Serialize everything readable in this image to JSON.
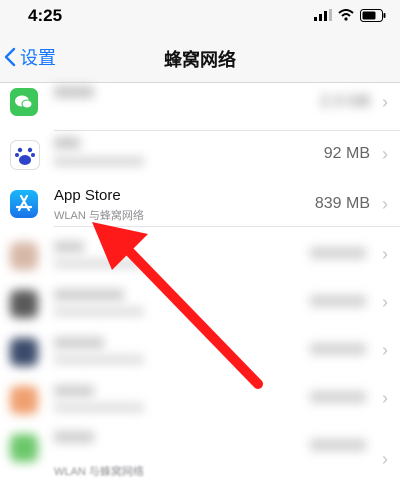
{
  "status": {
    "time": "4:25"
  },
  "nav": {
    "back_label": "设置",
    "title": "蜂窝网络"
  },
  "rows": [
    {
      "title": "",
      "subtitle": "",
      "size": "2.3 GB",
      "icon": "wechat-icon",
      "blurred": true
    },
    {
      "title": "",
      "subtitle": "",
      "size": "92 MB",
      "icon": "baidu-icon",
      "blurred": true
    },
    {
      "title": "App Store",
      "subtitle": "WLAN 与蜂窝网络",
      "size": "839 MB",
      "icon": "app-store-icon",
      "blurred": false
    },
    {
      "title": "",
      "subtitle": "",
      "size": "",
      "icon": "blurred-app-icon",
      "blurred": true
    },
    {
      "title": "",
      "subtitle": "",
      "size": "",
      "icon": "blurred-app-icon",
      "blurred": true
    },
    {
      "title": "",
      "subtitle": "",
      "size": "",
      "icon": "blurred-app-icon",
      "blurred": true
    },
    {
      "title": "",
      "subtitle": "",
      "size": "",
      "icon": "blurred-app-icon",
      "blurred": true
    },
    {
      "title": "",
      "subtitle": "WLAN 与蜂窝网络",
      "size": "",
      "icon": "blurred-app-icon",
      "blurred": true
    }
  ],
  "colors": {
    "accent": "#1677ff",
    "arrow": "#ff1a1a"
  }
}
